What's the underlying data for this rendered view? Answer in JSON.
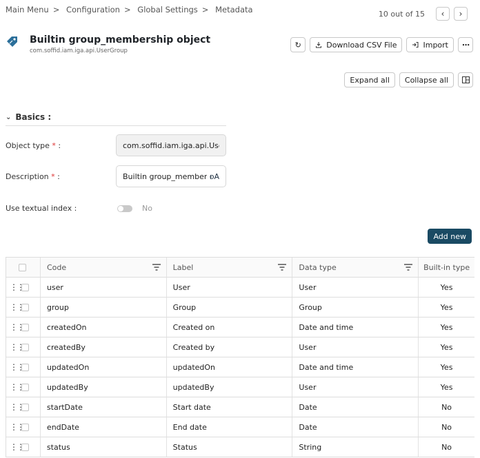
{
  "breadcrumb": [
    "Main Menu",
    "Configuration",
    "Global Settings",
    "Metadata"
  ],
  "breadcrumb_separator": ">",
  "pager": {
    "text": "10 out of 15"
  },
  "header": {
    "title": "Builtin group_membership object",
    "subtitle": "com.soffid.iam.iga.api.UserGroup"
  },
  "toolbar": {
    "download_label": "Download CSV File",
    "import_label": "Import"
  },
  "view_tools": {
    "expand_label": "Expand all",
    "collapse_label": "Collapse all"
  },
  "section": {
    "title": "Basics :"
  },
  "form": {
    "object_type_label": "Object type",
    "object_type_value": "com.soffid.iam.iga.api.UserGroup",
    "description_label": "Description",
    "description_value": "Builtin group_membership object",
    "textual_index_label": "Use textual index :",
    "textual_index_value": "No",
    "required_mark": "*",
    "label_suffix": " :"
  },
  "add_new_label": "Add new",
  "table": {
    "columns": [
      "Code",
      "Label",
      "Data type",
      "Built-in type"
    ],
    "rows": [
      [
        "user",
        "User",
        "User",
        "Yes"
      ],
      [
        "group",
        "Group",
        "Group",
        "Yes"
      ],
      [
        "createdOn",
        "Created on",
        "Date and time",
        "Yes"
      ],
      [
        "createdBy",
        "Created by",
        "User",
        "Yes"
      ],
      [
        "updatedOn",
        "updatedOn",
        "Date and time",
        "Yes"
      ],
      [
        "updatedBy",
        "updatedBy",
        "User",
        "Yes"
      ],
      [
        "startDate",
        "Start date",
        "Date",
        "No"
      ],
      [
        "endDate",
        "End date",
        "Date",
        "No"
      ],
      [
        "status",
        "Status",
        "String",
        "No"
      ]
    ]
  },
  "colors": {
    "accent": "#1a4a63",
    "tag_icon": "#2b6f9a",
    "required": "#d33333"
  }
}
